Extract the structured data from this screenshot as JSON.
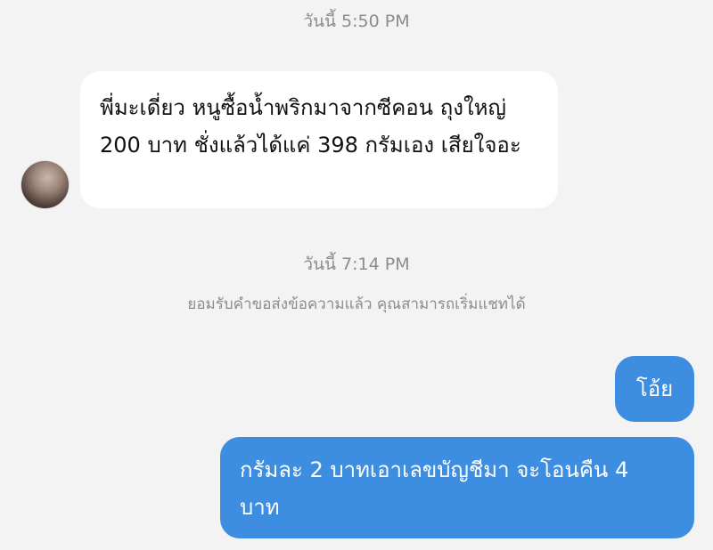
{
  "conversation": {
    "timestamp_1": "วันนี้ 5:50 PM",
    "timestamp_2": "วันนี้ 7:14 PM",
    "system_note": "ยอมรับคำขอส่งข้อความแล้ว คุณสามารถเริ่มแชทได้",
    "messages": [
      {
        "direction": "incoming",
        "text": "พี่มะเดี่ยว หนูซื้อน้ำพริกมาจากซีคอน ถุงใหญ่ 200 บาท ชั่งแล้วได้แค่ 398 กรัมเอง เสียใจอะ"
      },
      {
        "direction": "outgoing",
        "text": "โอ้ย"
      },
      {
        "direction": "outgoing",
        "text": "กรัมละ 2 บาทเอาเลขบัญชีมา จะโอนคืน 4 บาท"
      }
    ]
  },
  "colors": {
    "background": "#f3f3f3",
    "incoming_bubble": "#ffffff",
    "outgoing_bubble": "#3d8ee0",
    "meta_text": "#8c8c8c"
  }
}
